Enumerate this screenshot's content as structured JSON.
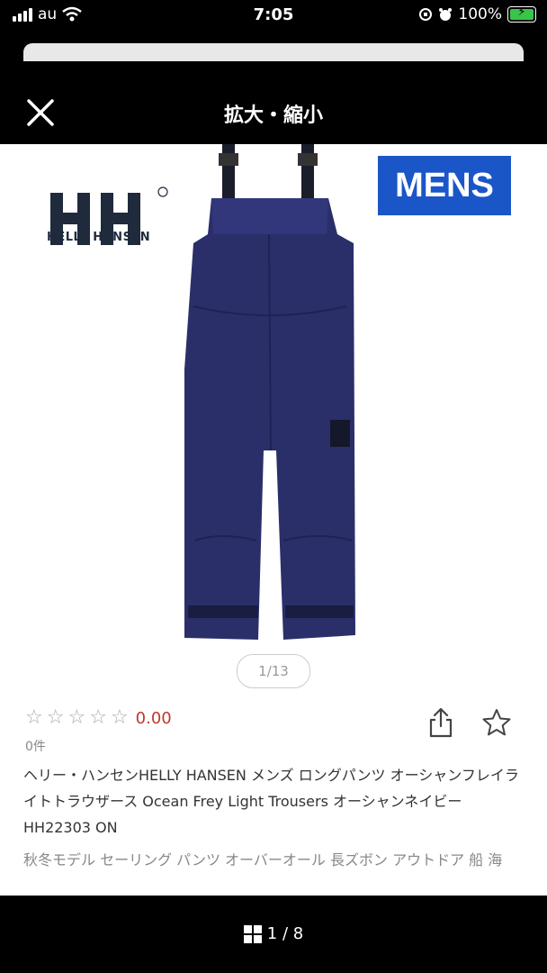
{
  "status_bar": {
    "carrier": "au",
    "time": "7:05",
    "battery": "100%"
  },
  "header": {
    "title": "拡大・縮小"
  },
  "product_image": {
    "brand_name": "HELLY HANSEN",
    "category_badge": "MENS"
  },
  "image_counter": "1/13",
  "rating": {
    "score": "0.00",
    "stars_filled": 0,
    "stars_total": 5,
    "review_count": "0件"
  },
  "product": {
    "name": "ヘリー・ハンセンHELLY HANSEN メンズ ロングパンツ オーシャンフレイライトトラウザース Ocean Frey Light Trousers オーシャンネイビー HH22303 ON",
    "description": "秋冬モデル セーリング パンツ オーバーオール 長ズボン アウトドア 船 海"
  },
  "bottom_bar": {
    "page_indicator": "1 / 8"
  },
  "colors": {
    "accent_blue": "#1a56c8",
    "navy": "#1f2a5c",
    "rating_red": "#c0392b"
  }
}
